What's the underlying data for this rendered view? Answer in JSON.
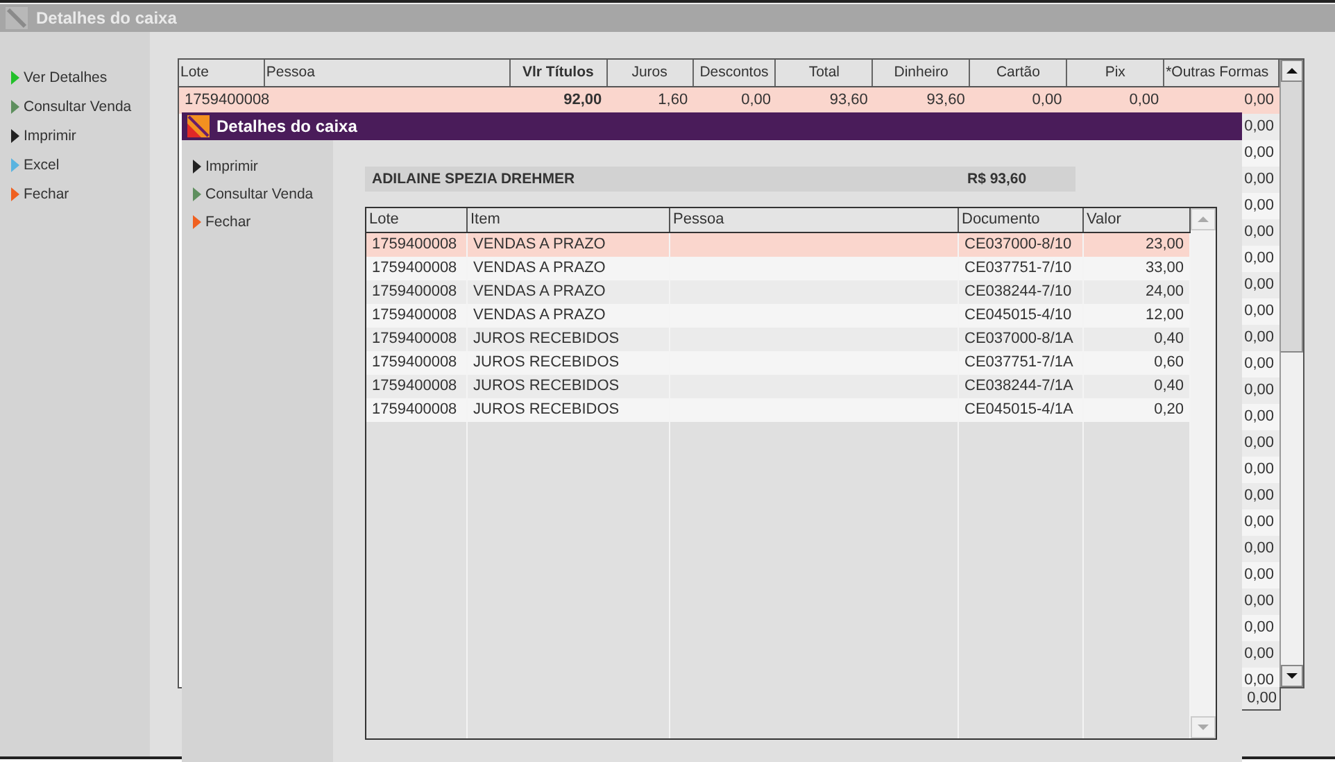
{
  "window": {
    "title": "Detalhes do caixa"
  },
  "sidebar": {
    "items": [
      {
        "label": "Ver Detalhes",
        "color": "#22c02a"
      },
      {
        "label": "Consultar Venda",
        "color": "#5e8f5e"
      },
      {
        "label": "Imprimir",
        "color": "#222222"
      },
      {
        "label": "Excel",
        "color": "#5ab4e0"
      },
      {
        "label": "Fechar",
        "color": "#f06020"
      }
    ]
  },
  "table": {
    "columns": [
      "Lote",
      "Pessoa",
      "Vlr Títulos",
      "Juros",
      "Descontos",
      "Total",
      "Dinheiro",
      "Cartão",
      "Pix",
      "*Outras Formas"
    ],
    "rows": [
      {
        "cells": [
          "1759400008",
          "",
          "92,00",
          "1,60",
          "0,00",
          "93,60",
          "93,60",
          "0,00",
          "0,00",
          "0,00"
        ],
        "selected": true
      }
    ],
    "covered_rows_outras_formas": [
      "0,00",
      "0,00",
      "0,00",
      "0,00",
      "0,00",
      "0,00",
      "0,00",
      "0,00",
      "0,00",
      "0,00",
      "0,00",
      "0,00",
      "0,00",
      "0,00",
      "0,00",
      "0,00",
      "0,00",
      "0,00",
      "0,00",
      "0,00",
      "0,00",
      "0,00"
    ],
    "footer_total": "0,00"
  },
  "dialog": {
    "title": "Detalhes do caixa",
    "sidebar": {
      "items": [
        {
          "label": "Imprimir",
          "color": "#222222"
        },
        {
          "label": "Consultar Venda",
          "color": "#5e8f5e"
        },
        {
          "label": "Fechar",
          "color": "#f06020"
        }
      ]
    },
    "customer": "ADILAINE SPEZIA DREHMER",
    "amount": "R$ 93,60",
    "table": {
      "columns": [
        "Lote",
        "Item",
        "Pessoa",
        "Documento",
        "Valor"
      ],
      "rows": [
        {
          "lote": "1759400008",
          "item": "VENDAS A PRAZO",
          "documento": "CE037000-8/10",
          "valor": "23,00",
          "selected": true
        },
        {
          "lote": "1759400008",
          "item": "VENDAS A PRAZO",
          "documento": "CE037751-7/10",
          "valor": "33,00",
          "selected": false
        },
        {
          "lote": "1759400008",
          "item": "VENDAS A PRAZO",
          "documento": "CE038244-7/10",
          "valor": "24,00",
          "selected": false
        },
        {
          "lote": "1759400008",
          "item": "VENDAS A PRAZO",
          "documento": "CE045015-4/10",
          "valor": "12,00",
          "selected": false
        },
        {
          "lote": "1759400008",
          "item": "JUROS RECEBIDOS",
          "documento": "CE037000-8/1A",
          "valor": "0,40",
          "selected": false
        },
        {
          "lote": "1759400008",
          "item": "JUROS RECEBIDOS",
          "documento": "CE037751-7/1A",
          "valor": "0,60",
          "selected": false
        },
        {
          "lote": "1759400008",
          "item": "JUROS RECEBIDOS",
          "documento": "CE038244-7/1A",
          "valor": "0,40",
          "selected": false
        },
        {
          "lote": "1759400008",
          "item": "JUROS RECEBIDOS",
          "documento": "CE045015-4/1A",
          "valor": "0,20",
          "selected": false
        }
      ]
    }
  }
}
